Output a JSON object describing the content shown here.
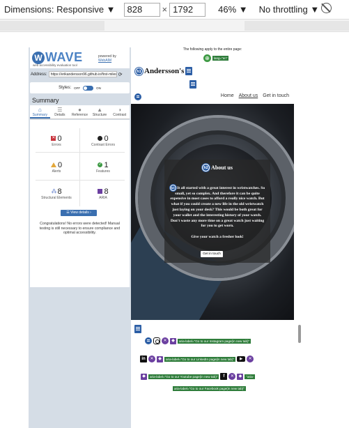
{
  "toolbar": {
    "dimensions_label": "Dimensions: Responsive ▼",
    "width": "828",
    "times": "×",
    "height": "1792",
    "zoom": "46% ▼",
    "throttle": "No throttling ▼"
  },
  "wave": {
    "logo_letter": "W",
    "title": "WAVE",
    "subtitle": "web accessibility evaluation tool",
    "powered_by": "powered by",
    "webaim": "WebAIM",
    "address_label": "Address:",
    "address_value": "https://erikandersson96.github.io/first-miles",
    "styles_label": "Styles:",
    "styles_off": "OFF",
    "styles_on": "ON",
    "summary_heading": "Summary",
    "tabs": [
      "Summary",
      "Details",
      "Reference",
      "Structure",
      "Contrast"
    ],
    "stats": {
      "errors": {
        "value": "0",
        "label": "Errors"
      },
      "contrast_errors": {
        "value": "0",
        "label": "Contrast Errors"
      },
      "alerts": {
        "value": "0",
        "label": "Alerts"
      },
      "features": {
        "value": "1",
        "label": "Features"
      },
      "structural": {
        "value": "8",
        "label": "Structural Elements"
      },
      "aria": {
        "value": "8",
        "label": "ARIA"
      }
    },
    "view_details": "☰ View details ›",
    "congrats": "Congratulations! No errors were detected! Manual testing is still necessary to ensure compliance and optimal accessibility."
  },
  "page": {
    "apply_all": "The following apply to the entire page:",
    "lang_tag": "lang=\"en\"",
    "h1_badge": "h1",
    "brand": "Andersson's",
    "nav": [
      "Home",
      "About us",
      "Get in touch"
    ],
    "h2_badge": "h2",
    "about_heading": "About us",
    "p_badge": "h3",
    "about_text": "It all started with a great interest in wristwatches. So small, yet so complex. And therefore it can be quite expensive in most cases to afford a really nice watch. But what if you could create a new life in the old wristwatch just laying on your desk? This would be both great for your wallet and the interesting history of your watch. Don't waste any more time on a great watch just waiting for you to get worn.",
    "about_tagline": "Give your watch a fresher look!",
    "cta": "Get in touch",
    "social": {
      "instagram_tag": "aria-label=\"Go to our Instagram page(in new tab)\"",
      "linkedin_tag": "aria-label=\"Go to our LinkedIn page(in new tab)\"",
      "youtube_tag": "aria-label=\"Go to our Youtube page(in new tab)\"",
      "facebook_tag": "aria-label=\"Go to our Facebook page(in new tab)\"",
      "linkedin_glyph": "in",
      "youtube_glyph": "▶",
      "facebook_glyph": "f"
    }
  }
}
